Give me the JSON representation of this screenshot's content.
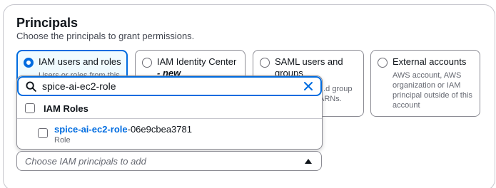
{
  "section": {
    "title": "Principals",
    "subtitle": "Choose the principals to grant permissions."
  },
  "principal_types": [
    {
      "label": "IAM users and roles",
      "tag": "",
      "description": "Users or roles from this",
      "selected": true
    },
    {
      "label": "IAM Identity Center",
      "tag": "- new",
      "description": "",
      "selected": false
    },
    {
      "label": "SAML users and groups",
      "tag": "",
      "description": "...d group ARNs.",
      "selected": false
    },
    {
      "label": "External accounts",
      "tag": "",
      "description": "AWS account, AWS organization or IAM principal outside of this account",
      "selected": false
    }
  ],
  "search": {
    "value": "spice-ai-ec2-role",
    "icon": "search-icon",
    "clear_icon": "close-icon"
  },
  "results": {
    "group_label": "IAM Roles",
    "options": [
      {
        "name_match": "spice-ai-ec2-role",
        "name_rest": "-06e9cbea3781",
        "type": "Role"
      }
    ]
  },
  "principals_select": {
    "placeholder": "Choose IAM principals to add",
    "icon": "caret-up-icon"
  },
  "colors": {
    "accent": "#006ce0",
    "selected_bg": "#f0fbff",
    "border": "#8c8c94",
    "text": "#0f141a",
    "muted": "#656871"
  }
}
